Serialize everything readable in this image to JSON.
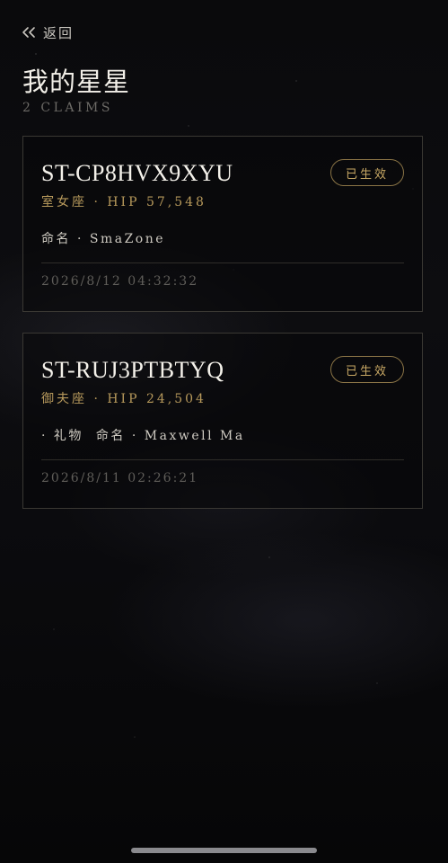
{
  "nav": {
    "back_label": "返回"
  },
  "header": {
    "title": "我的星星",
    "claims_count": "2 CLAIMS"
  },
  "cards": [
    {
      "claim_id": "ST-CP8HVX9XYU",
      "status": "已生效",
      "constellation": "室女座 · HIP 57,548",
      "gift_prefix": "",
      "name_line": "命名 · SmaZone",
      "timestamp": "2026/8/12 04:32:32"
    },
    {
      "claim_id": "ST-RUJ3PTBTYQ",
      "status": "已生效",
      "constellation": "御夫座 · HIP 24,504",
      "gift_prefix": "· 礼物",
      "name_line": "命名 · Maxwell Ma",
      "timestamp": "2026/8/11 02:26:21"
    }
  ],
  "colors": {
    "accent_gold": "#c9a965",
    "badge_border": "#8a7446",
    "background": "#0b0b0e"
  }
}
